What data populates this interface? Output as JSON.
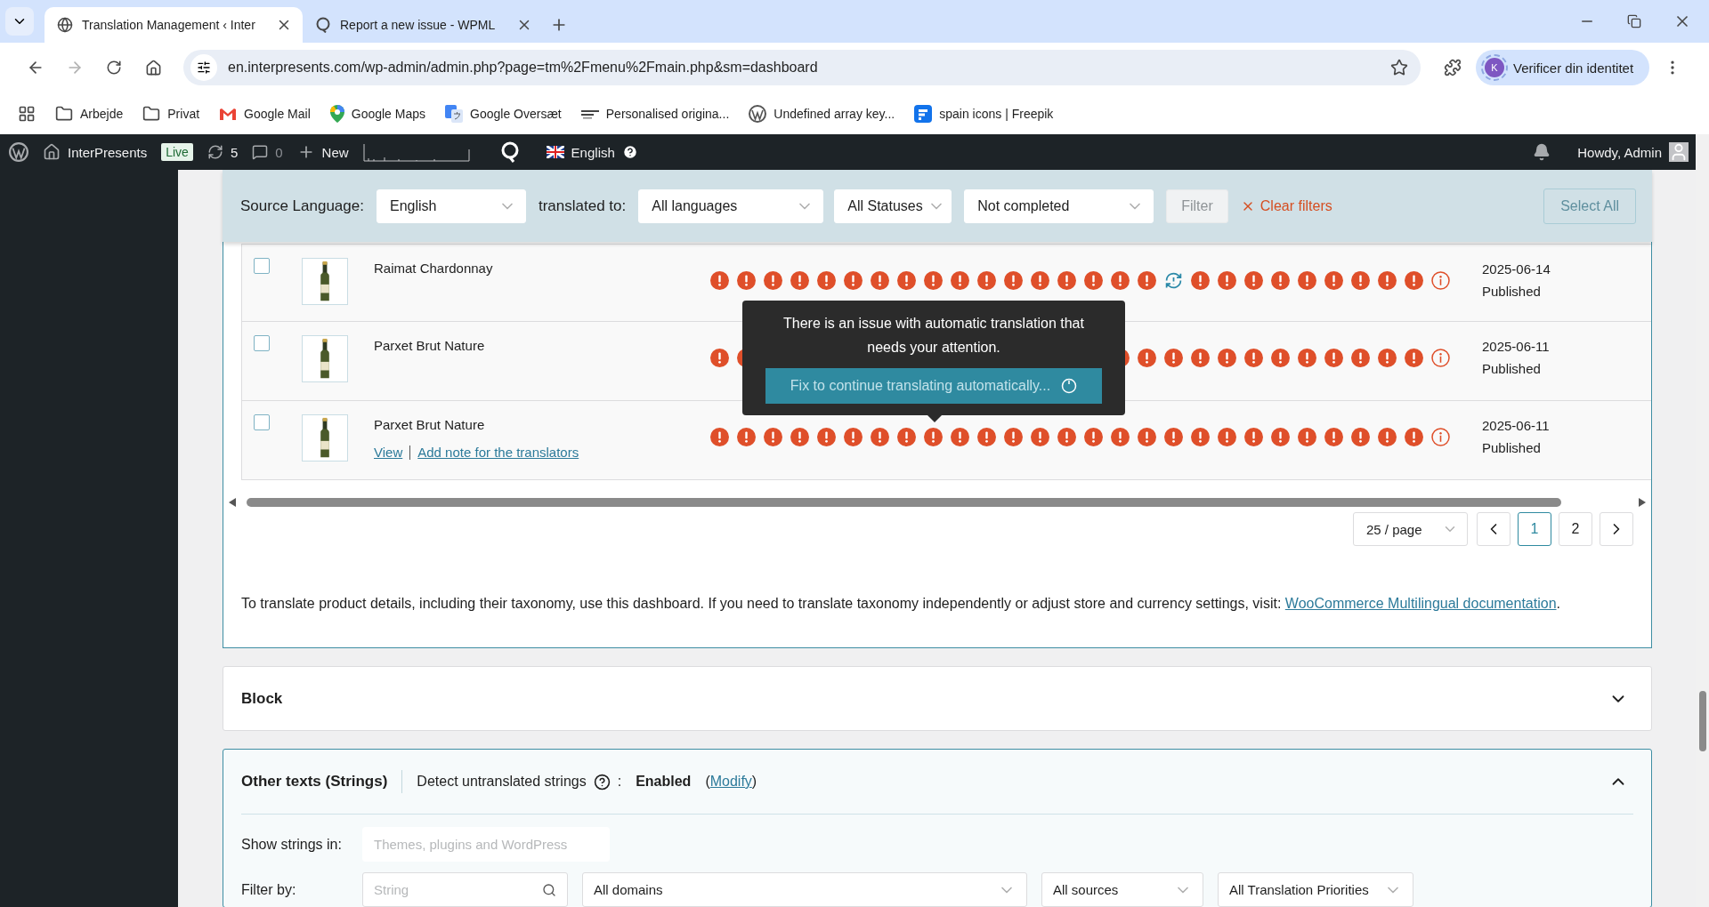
{
  "browser": {
    "tabs": [
      {
        "title": "Translation Management ‹ Inter",
        "kind": "globe",
        "selected": true
      },
      {
        "title": "Report a new issue - WPML",
        "kind": "support",
        "selected": false
      }
    ],
    "url": "en.interpresents.com/wp-admin/admin.php?page=tm%2Fmenu%2Fmain.php&sm=dashboard",
    "profile": {
      "initial": "K",
      "label": "Verificer din identitet"
    },
    "bookmarks": [
      {
        "label": "Arbejde",
        "kind": "folder"
      },
      {
        "label": "Privat",
        "kind": "folder"
      },
      {
        "label": "Google Mail",
        "kind": "mail"
      },
      {
        "label": "Google Maps",
        "kind": "maps"
      },
      {
        "label": "Google Oversæt",
        "kind": "translate"
      },
      {
        "label": "Personalised origina...",
        "kind": "brand"
      },
      {
        "label": "Undefined array key...",
        "kind": "wordpress"
      },
      {
        "label": "spain icons | Freepik",
        "kind": "freepik"
      }
    ]
  },
  "admin_bar": {
    "site": "InterPresents",
    "badge": "Live",
    "updates": "5",
    "comments": "0",
    "new": "New",
    "language": "English",
    "greeting": "Howdy, Admin"
  },
  "filters": {
    "source_label": "Source Language:",
    "source": "English",
    "target_label": "translated to:",
    "target": "All languages",
    "status": "All Statuses",
    "completion": "Not completed",
    "filter_button": {
      "label": "Filter",
      "disabled": true
    },
    "clear": "Clear filters",
    "select_all": {
      "label": "Select All",
      "disabled": true
    }
  },
  "rows": [
    {
      "title": "Raimat Chardonnay",
      "checked": false,
      "date": "2025-06-14",
      "status": "Published",
      "statuses": [
        {
          "kind": "issue"
        },
        {
          "kind": "issue"
        },
        {
          "kind": "issue"
        },
        {
          "kind": "issue"
        },
        {
          "kind": "issue"
        },
        {
          "kind": "issue"
        },
        {
          "kind": "issue"
        },
        {
          "kind": "issue"
        },
        {
          "kind": "issue"
        },
        {
          "kind": "issue"
        },
        {
          "kind": "issue"
        },
        {
          "kind": "issue"
        },
        {
          "kind": "issue"
        },
        {
          "kind": "issue"
        },
        {
          "kind": "issue"
        },
        {
          "kind": "issue"
        },
        {
          "kind": "issue"
        },
        {
          "kind": "sync"
        },
        {
          "kind": "issue"
        },
        {
          "kind": "issue"
        },
        {
          "kind": "issue"
        },
        {
          "kind": "issue"
        },
        {
          "kind": "issue"
        },
        {
          "kind": "issue"
        },
        {
          "kind": "issue"
        },
        {
          "kind": "issue"
        },
        {
          "kind": "issue"
        },
        {
          "kind": "info"
        }
      ]
    },
    {
      "title": "Parxet Brut Nature",
      "checked": false,
      "date": "2025-06-11",
      "status": "Published",
      "statuses": [
        {
          "kind": "issue"
        },
        {
          "kind": "issue"
        },
        {
          "kind": "covered"
        },
        {
          "kind": "covered"
        },
        {
          "kind": "covered"
        },
        {
          "kind": "covered"
        },
        {
          "kind": "covered"
        },
        {
          "kind": "covered"
        },
        {
          "kind": "covered"
        },
        {
          "kind": "covered"
        },
        {
          "kind": "covered"
        },
        {
          "kind": "covered"
        },
        {
          "kind": "covered"
        },
        {
          "kind": "covered"
        },
        {
          "kind": "covered"
        },
        {
          "kind": "issue"
        },
        {
          "kind": "issue"
        },
        {
          "kind": "issue"
        },
        {
          "kind": "issue"
        },
        {
          "kind": "issue"
        },
        {
          "kind": "issue"
        },
        {
          "kind": "issue"
        },
        {
          "kind": "issue"
        },
        {
          "kind": "issue"
        },
        {
          "kind": "issue"
        },
        {
          "kind": "issue"
        },
        {
          "kind": "issue"
        },
        {
          "kind": "info"
        }
      ]
    },
    {
      "title": "Parxet Brut Nature",
      "checked": false,
      "date": "2025-06-11",
      "status": "Published",
      "actions": [
        "View",
        "Add note for the translators"
      ],
      "statuses": [
        {
          "kind": "issue"
        },
        {
          "kind": "issue"
        },
        {
          "kind": "issue"
        },
        {
          "kind": "issue"
        },
        {
          "kind": "issue"
        },
        {
          "kind": "issue"
        },
        {
          "kind": "issue"
        },
        {
          "kind": "issue"
        },
        {
          "kind": "issue"
        },
        {
          "kind": "issue"
        },
        {
          "kind": "issue"
        },
        {
          "kind": "issue"
        },
        {
          "kind": "issue"
        },
        {
          "kind": "issue"
        },
        {
          "kind": "issue"
        },
        {
          "kind": "issue"
        },
        {
          "kind": "issue"
        },
        {
          "kind": "issue"
        },
        {
          "kind": "issue"
        },
        {
          "kind": "issue"
        },
        {
          "kind": "issue"
        },
        {
          "kind": "issue"
        },
        {
          "kind": "issue"
        },
        {
          "kind": "issue"
        },
        {
          "kind": "issue"
        },
        {
          "kind": "issue"
        },
        {
          "kind": "issue"
        },
        {
          "kind": "info"
        }
      ]
    }
  ],
  "tooltip": {
    "text": "There is an issue with automatic translation that needs your attention.",
    "button": "Fix to continue translating automatically..."
  },
  "pagination": {
    "per_page": "25 / page",
    "pages": [
      {
        "label": "1",
        "selected": true
      },
      {
        "label": "2",
        "selected": false
      }
    ]
  },
  "note": {
    "text": "To translate product details, including their taxonomy, use this dashboard. If you need to translate taxonomy independently or adjust store and currency settings, visit: ",
    "link": "WooCommerce Multilingual documentation",
    "after": "."
  },
  "sections": [
    {
      "title": "Block",
      "expanded": false
    }
  ],
  "strings": {
    "title": "Other texts (Strings)",
    "expanded": true,
    "detect_label": "Detect untranslated strings",
    "colon": ":",
    "detect_value": "Enabled",
    "open": "(",
    "modify": "Modify",
    "close": ")",
    "show_label": "Show strings in:",
    "show_placeholder": "Themes, plugins and WordPress",
    "filter_label": "Filter by:",
    "search_placeholder": "String",
    "domain": "All domains",
    "source": "All sources",
    "priority": "All Translation Priorities"
  }
}
